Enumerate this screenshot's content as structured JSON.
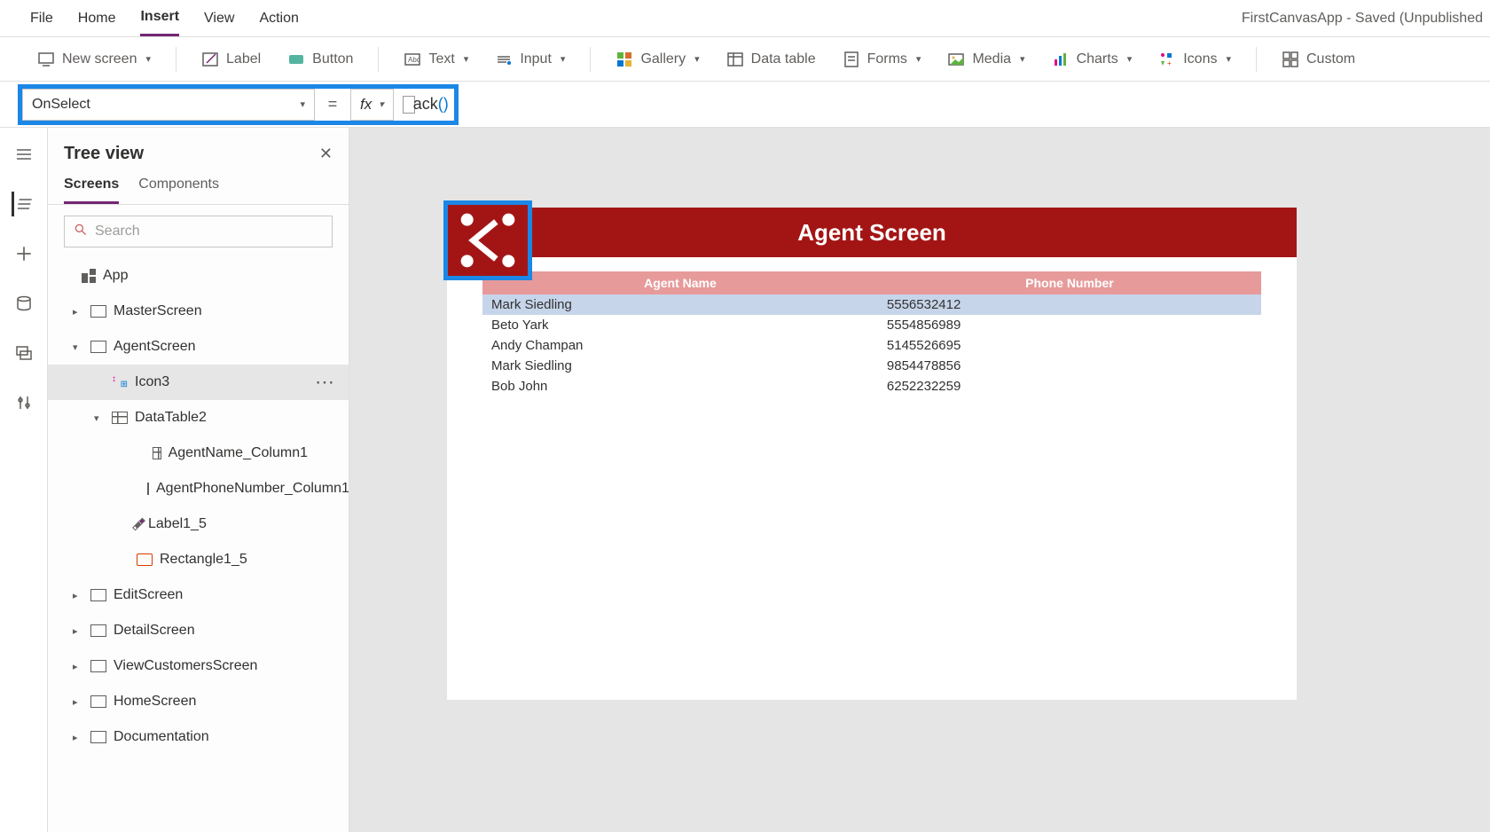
{
  "menu": [
    "File",
    "Home",
    "Insert",
    "View",
    "Action"
  ],
  "menu_active_index": 2,
  "app_title": "FirstCanvasApp - Saved (Unpublished",
  "ribbon": {
    "new_screen": "New screen",
    "label": "Label",
    "button": "Button",
    "text": "Text",
    "input": "Input",
    "gallery": "Gallery",
    "data_table": "Data table",
    "forms": "Forms",
    "media": "Media",
    "charts": "Charts",
    "icons": "Icons",
    "custom": "Custom"
  },
  "property": "OnSelect",
  "formula": {
    "fn_part": "ack",
    "full_hint": "Back()"
  },
  "tree": {
    "title": "Tree view",
    "tabs": [
      "Screens",
      "Components"
    ],
    "search_placeholder": "Search",
    "app_label": "App",
    "nodes": [
      {
        "label": "MasterScreen",
        "depth": 1,
        "chev": ">",
        "icon": "screen"
      },
      {
        "label": "AgentScreen",
        "depth": 1,
        "chev": "v",
        "icon": "screen"
      },
      {
        "label": "Icon3",
        "depth": 2,
        "icon": "arrows",
        "selected": true
      },
      {
        "label": "DataTable2",
        "depth": 2,
        "chev": "v",
        "icon": "table"
      },
      {
        "label": "AgentName_Column1",
        "depth": 4,
        "icon": "table"
      },
      {
        "label": "AgentPhoneNumber_Column1",
        "depth": 4,
        "icon": "table"
      },
      {
        "label": "Label1_5",
        "depth": 3,
        "icon": "pencil"
      },
      {
        "label": "Rectangle1_5",
        "depth": 3,
        "icon": "rect"
      },
      {
        "label": "EditScreen",
        "depth": 1,
        "chev": ">",
        "icon": "screen"
      },
      {
        "label": "DetailScreen",
        "depth": 1,
        "chev": ">",
        "icon": "screen"
      },
      {
        "label": "ViewCustomersScreen",
        "depth": 1,
        "chev": ">",
        "icon": "screen"
      },
      {
        "label": "HomeScreen",
        "depth": 1,
        "chev": ">",
        "icon": "screen"
      },
      {
        "label": "Documentation",
        "depth": 1,
        "chev": ">",
        "icon": "screen"
      }
    ]
  },
  "canvas": {
    "title": "Agent Screen",
    "columns": [
      "Agent Name",
      "Phone Number"
    ],
    "rows": [
      {
        "name": "Mark Siedling",
        "phone": "5556532412",
        "selected": true
      },
      {
        "name": "Beto Yark",
        "phone": "5554856989"
      },
      {
        "name": "Andy Champan",
        "phone": "5145526695"
      },
      {
        "name": "Mark Siedling",
        "phone": "9854478856"
      },
      {
        "name": "Bob John",
        "phone": "6252232259"
      }
    ]
  }
}
